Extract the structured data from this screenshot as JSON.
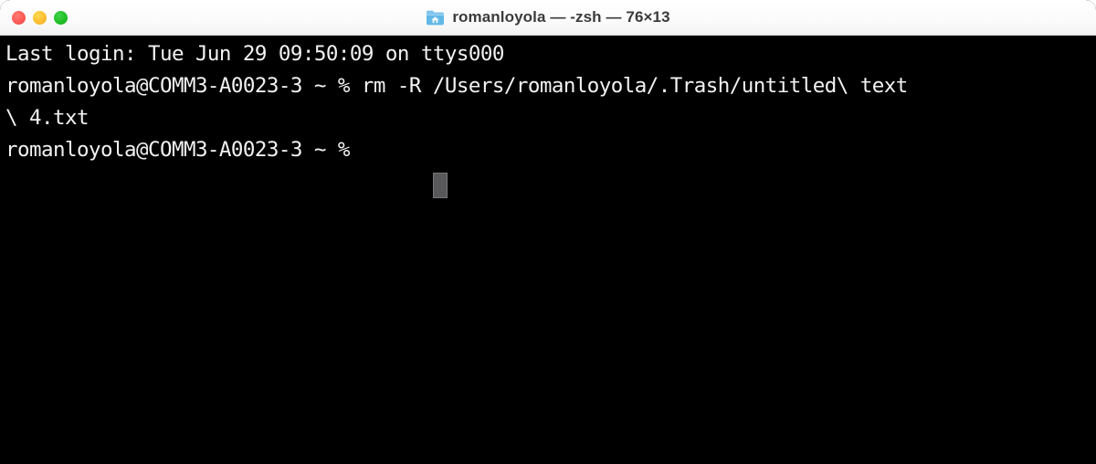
{
  "window": {
    "title": "romanloyola — -zsh — 76×13",
    "icon": "home-folder-icon",
    "traffic_lights": {
      "close_label": "Close",
      "minimize_label": "Minimize",
      "maximize_label": "Maximize",
      "close_color": "#fc5753",
      "minimize_color": "#fdbc2f",
      "maximize_color": "#1fbd23"
    },
    "titlebar_background": "#ffffff",
    "titlebar_text_color": "#3b3b3b"
  },
  "terminal": {
    "background": "#000000",
    "foreground": "#f2f2f2",
    "cursor_color": "#58585a",
    "columns": 76,
    "rows": 13,
    "shell": "-zsh",
    "lines": [
      "Last login: Tue Jun 29 09:50:09 on ttys000",
      "romanloyola@COMM3-A0023-3 ~ % rm -R /Users/romanloyola/.Trash/untitled\\ text",
      "\\ 4.txt",
      "romanloyola@COMM3-A0023-3 ~ % "
    ],
    "prompt": "romanloyola@COMM3-A0023-3 ~ %",
    "last_command": "rm -R /Users/romanloyola/.Trash/untitled\\ text\\ 4.txt",
    "user": "romanloyola",
    "host": "COMM3-A0023-3",
    "cwd": "~",
    "tty": "ttys000",
    "login_time": "Tue Jun 29 09:50:09"
  }
}
